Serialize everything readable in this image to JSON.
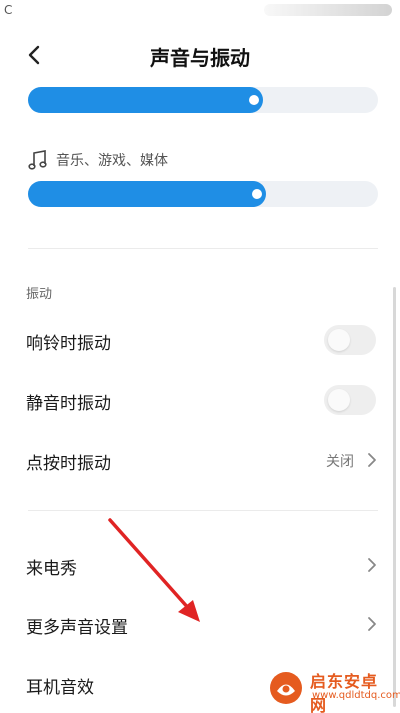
{
  "status_bar": {
    "left_text": "C"
  },
  "header": {
    "title": "声音与振动",
    "back_icon": "chevron-left-icon"
  },
  "ringtone_volume": {
    "level": 0.67,
    "fill_color": "#1f8ee5",
    "track_color": "#eef1f5"
  },
  "media_volume": {
    "label": "音乐、游戏、媒体",
    "icon": "music-note-icon",
    "level": 0.68
  },
  "vibration": {
    "section_title": "振动",
    "ring_vibrate": {
      "label": "响铃时振动",
      "enabled": false
    },
    "silent_vibrate": {
      "label": "静音时振动",
      "enabled": false
    },
    "tap_vibrate": {
      "label": "点按时振动",
      "value": "关闭"
    }
  },
  "more": {
    "caller_show": {
      "label": "来电秀"
    },
    "more_sound_settings": {
      "label": "更多声音设置"
    },
    "headphone_effects": {
      "label": "耳机音效"
    }
  },
  "annotation": {
    "color": "#e02424"
  },
  "watermark": {
    "title": "启东安卓网",
    "url": "www.qdldtdq.com"
  }
}
